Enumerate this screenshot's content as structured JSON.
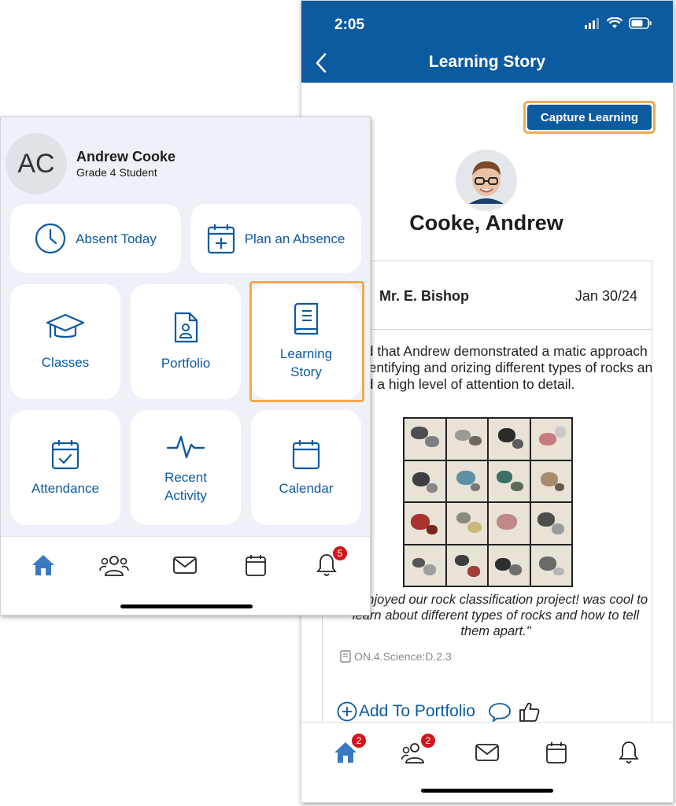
{
  "right_phone": {
    "status": {
      "time": "2:05"
    },
    "nav": {
      "title": "Learning Story"
    },
    "capture_button": "Capture Learning",
    "student_name": "Cooke, Andrew",
    "story": {
      "teacher": "Mr. E. Bishop",
      "date": "Jan 30/24",
      "text": "ed that Andrew demonstrated a matic approach to identifying and orizing different types of rocks and ed a high level of attention to detail.",
      "quote": "lly enjoyed our rock classification project! was cool to learn about different types of rocks and how to tell them apart.\"",
      "tag": "ON.4.Science:D.2.3",
      "add_to_portfolio": "Add To Portfolio"
    },
    "tabbar": {
      "home_badge": "2",
      "people_badge": "2"
    }
  },
  "left_phone": {
    "profile": {
      "initials": "AC",
      "name": "Andrew Cooke",
      "role": "Grade 4 Student"
    },
    "tiles": {
      "absent_today": "Absent Today",
      "plan_absence": "Plan an Absence",
      "classes": "Classes",
      "portfolio": "Portfolio",
      "learning_story_line1": "Learning",
      "learning_story_line2": "Story",
      "attendance": "Attendance",
      "recent_activity_line1": "Recent",
      "recent_activity_line2": "Activity",
      "calendar": "Calendar"
    },
    "tabbar": {
      "notifications_badge": "5"
    }
  },
  "colors": {
    "brand": "#0c5aa0",
    "highlight": "#f0a954",
    "badge": "#d3141d",
    "panel_bg": "#eef1f7"
  }
}
